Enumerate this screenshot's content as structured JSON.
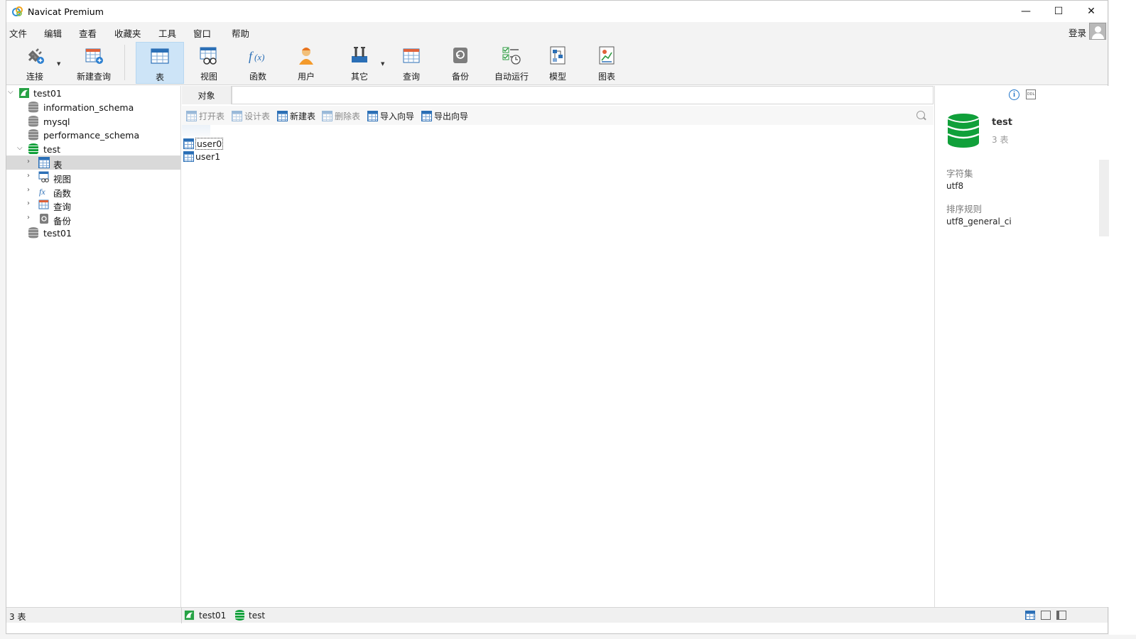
{
  "window": {
    "title": "Navicat Premium",
    "minimize": "—",
    "maximize": "☐",
    "close": "✕"
  },
  "menu": {
    "items": [
      "文件",
      "编辑",
      "查看",
      "收藏夹",
      "工具",
      "窗口",
      "帮助"
    ],
    "login": "登录"
  },
  "toolbar": {
    "buttons": [
      "连接",
      "新建查询",
      "表",
      "视图",
      "函数",
      "用户",
      "其它",
      "查询",
      "备份",
      "自动运行",
      "模型",
      "图表"
    ],
    "active": "表"
  },
  "tree": {
    "connection": "test01",
    "databases": [
      "information_schema",
      "mysql",
      "performance_schema",
      "test"
    ],
    "test_children": [
      "表",
      "视图",
      "函数",
      "查询",
      "备份"
    ],
    "last_db": "test01"
  },
  "center": {
    "tab_label": "对象",
    "actions": [
      "打开表",
      "设计表",
      "新建表",
      "删除表",
      "导入向导",
      "导出向导"
    ],
    "objects": [
      "user0",
      "user1"
    ]
  },
  "info": {
    "db_name": "test",
    "table_count": "3 表",
    "charset_label": "字符集",
    "charset_value": "utf8",
    "collation_label": "排序规则",
    "collation_value": "utf8_general_ci"
  },
  "status": {
    "count": "3 表",
    "connection": "test01",
    "database": "test"
  },
  "colors": {
    "accent_blue": "#2b6fb6",
    "db_green": "#10a03a",
    "active_tool_bg": "#cde4f7"
  }
}
